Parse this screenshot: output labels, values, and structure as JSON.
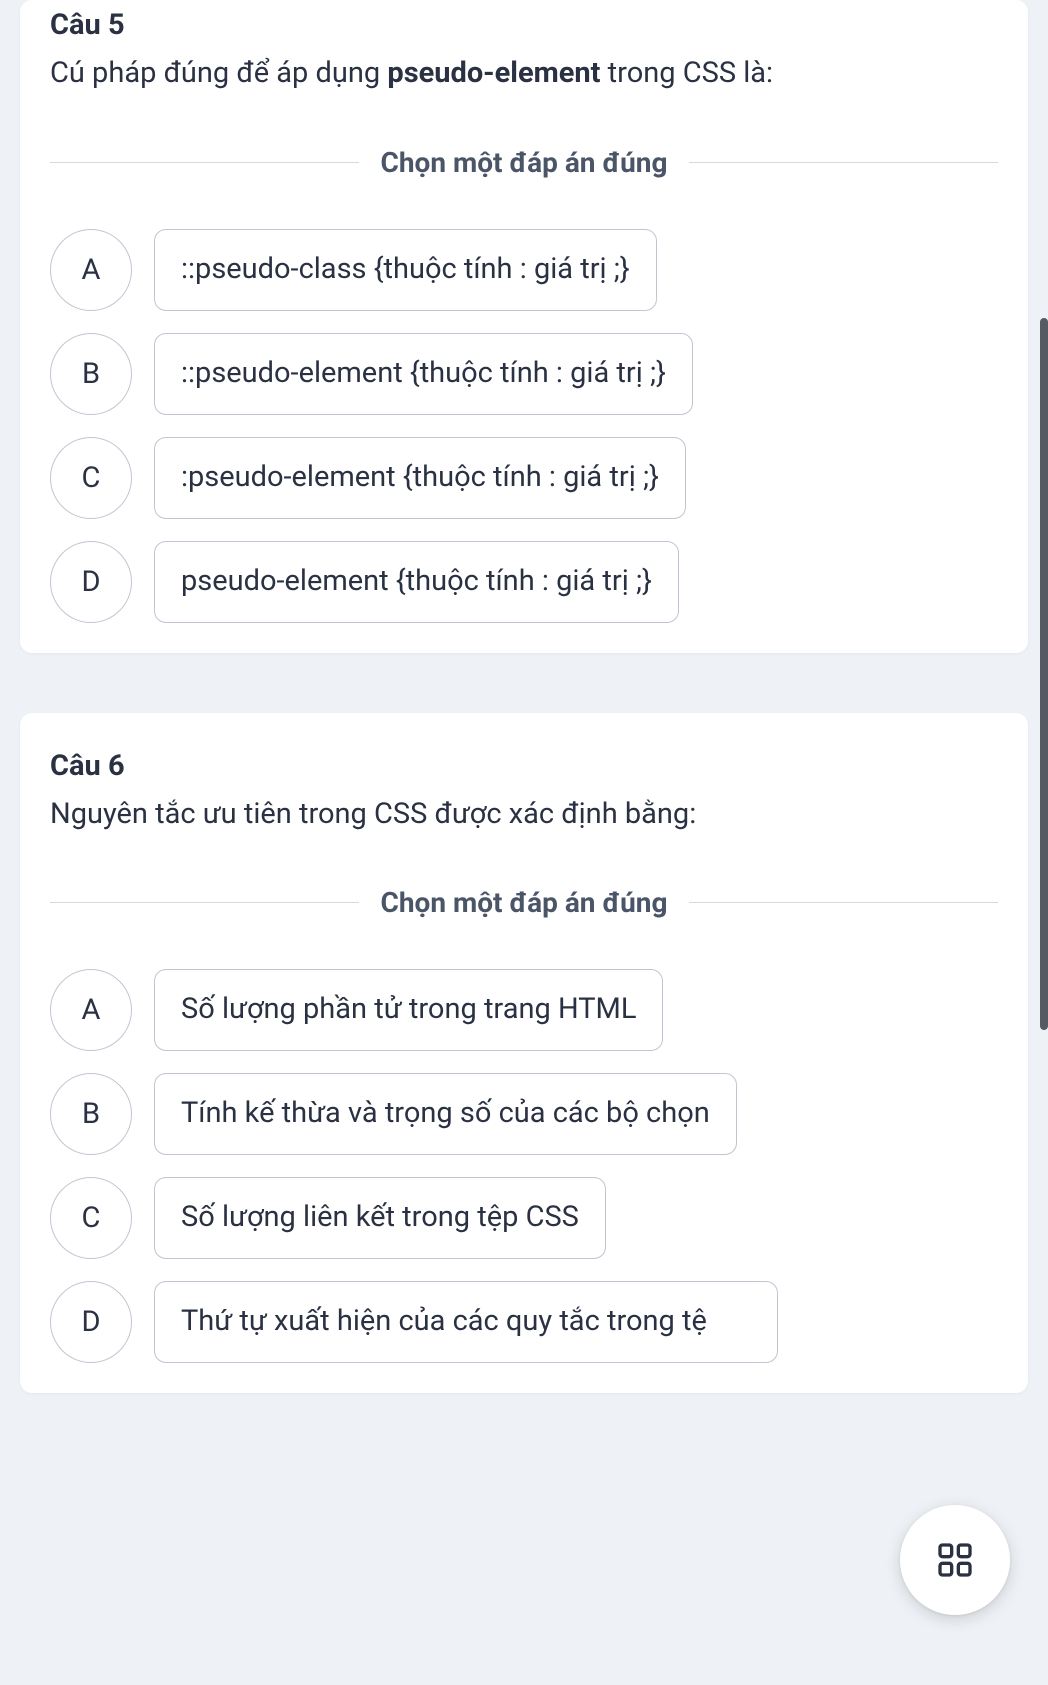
{
  "q5": {
    "title": "Câu 5",
    "text_before": "Cú pháp đúng để áp dụng ",
    "text_bold": "pseudo-element",
    "text_after": " trong CSS là:",
    "instruction": "Chọn một đáp án đúng",
    "options": [
      {
        "letter": "A",
        "text": "::pseudo-class {thuộc tính : giá trị ;}"
      },
      {
        "letter": "B",
        "text": "::pseudo-element {thuộc tính : giá trị ;}"
      },
      {
        "letter": "C",
        "text": ":pseudo-element {thuộc tính : giá trị ;}"
      },
      {
        "letter": "D",
        "text": "pseudo-element {thuộc tính : giá trị ;}"
      }
    ]
  },
  "q6": {
    "title": "Câu 6",
    "text": "Nguyên tắc ưu tiên trong CSS được xác định bằng:",
    "instruction": "Chọn một đáp án đúng",
    "options": [
      {
        "letter": "A",
        "text": "Số lượng phần tử trong trang HTML"
      },
      {
        "letter": "B",
        "text": "Tính kế thừa và trọng số của các bộ chọn"
      },
      {
        "letter": "C",
        "text": "Số lượng liên kết trong tệp CSS"
      },
      {
        "letter": "D",
        "text": "Thứ tự xuất hiện của các quy tắc trong tệ"
      }
    ]
  }
}
